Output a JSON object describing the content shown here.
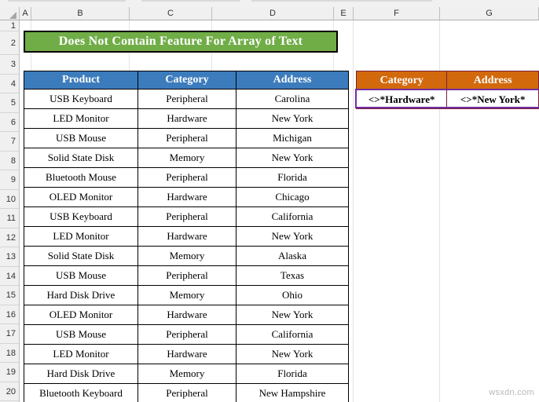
{
  "app": {
    "watermark": "wsxdn.com"
  },
  "grid": {
    "column_headers": [
      "A",
      "B",
      "C",
      "D",
      "E",
      "F",
      "G"
    ],
    "row_headers": [
      "1",
      "2",
      "3",
      "4",
      "5",
      "6",
      "7",
      "8",
      "9",
      "10",
      "11",
      "12",
      "13",
      "14",
      "15",
      "16",
      "17",
      "18",
      "19",
      "20"
    ]
  },
  "title_banner": {
    "text": "Does Not Contain Feature For Array of Text",
    "fill": "#70ad47",
    "text_color": "#ffffff",
    "border": "#000000"
  },
  "main_table": {
    "header_fill": "#3c7cbd",
    "header_text_color": "#ffffff",
    "border": "#000000",
    "columns": [
      "Product",
      "Category",
      "Address"
    ],
    "rows": [
      [
        "USB Keyboard",
        "Peripheral",
        "Carolina"
      ],
      [
        "LED Monitor",
        "Hardware",
        "New York"
      ],
      [
        "USB Mouse",
        "Peripheral",
        "Michigan"
      ],
      [
        "Solid State Disk",
        "Memory",
        "New York"
      ],
      [
        "Bluetooth Mouse",
        "Peripheral",
        "Florida"
      ],
      [
        "OLED Monitor",
        "Hardware",
        "Chicago"
      ],
      [
        "USB Keyboard",
        "Peripheral",
        "California"
      ],
      [
        "LED Monitor",
        "Hardware",
        "New York"
      ],
      [
        "Solid State Disk",
        "Memory",
        "Alaska"
      ],
      [
        "USB Mouse",
        "Peripheral",
        "Texas"
      ],
      [
        "Hard Disk Drive",
        "Memory",
        "Ohio"
      ],
      [
        "OLED Monitor",
        "Hardware",
        "New York"
      ],
      [
        "USB Mouse",
        "Peripheral",
        "California"
      ],
      [
        "LED Monitor",
        "Hardware",
        "New York"
      ],
      [
        "Hard Disk Drive",
        "Memory",
        "Florida"
      ],
      [
        "Bluetooth Keyboard",
        "Peripheral",
        "New Hampshire"
      ]
    ]
  },
  "criteria_table": {
    "header_fill": "#d2690d",
    "header_text_color": "#ffffff",
    "border": "#7b1f3a",
    "selection_border": "#7030a0",
    "columns": [
      "Category",
      "Address"
    ],
    "values": [
      "<>*Hardware*",
      "<>*New York*"
    ]
  }
}
